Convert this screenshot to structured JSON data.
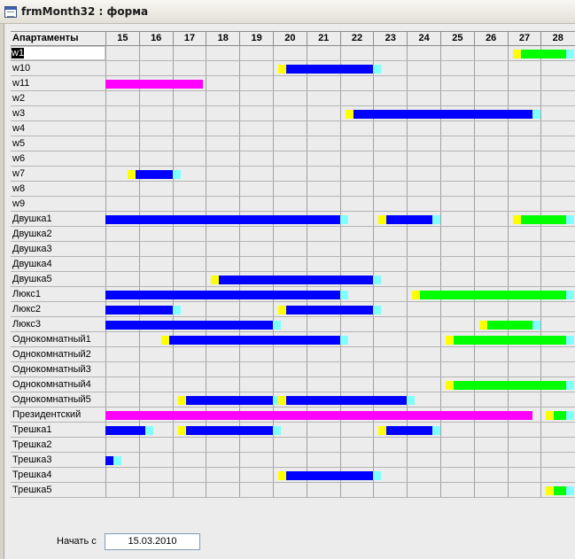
{
  "window": {
    "title": "frmMonth32 : форма"
  },
  "header": {
    "apartments": "Апартаменты",
    "days": [
      "15",
      "16",
      "17",
      "18",
      "19",
      "20",
      "21",
      "22",
      "23",
      "24",
      "25",
      "26",
      "27",
      "28"
    ]
  },
  "colors": {
    "blue": "#0000ff",
    "magenta": "#ff00ff",
    "green": "#00ff00",
    "yellow": "#ffff00",
    "cyan": "#80ffff"
  },
  "rows": [
    {
      "name": "w1",
      "bars": [
        {
          "from": 27.0,
          "to": 28.75,
          "color": "green"
        }
      ]
    },
    {
      "name": "w10",
      "bars": [
        {
          "from": 20.0,
          "to": 23.0,
          "color": "blue"
        }
      ]
    },
    {
      "name": "w11",
      "bars": [
        {
          "from": 15.0,
          "to": 17.9,
          "color": "magenta"
        }
      ]
    },
    {
      "name": "w2",
      "bars": []
    },
    {
      "name": "w3",
      "bars": [
        {
          "from": 22.0,
          "to": 27.75,
          "color": "blue"
        }
      ]
    },
    {
      "name": "w4",
      "bars": []
    },
    {
      "name": "w5",
      "bars": []
    },
    {
      "name": "w6",
      "bars": []
    },
    {
      "name": "w7",
      "bars": [
        {
          "from": 15.5,
          "to": 17.0,
          "color": "blue"
        }
      ]
    },
    {
      "name": "w8",
      "bars": []
    },
    {
      "name": "w9",
      "bars": []
    },
    {
      "name": "Двушка1",
      "bars": [
        {
          "from": 15.0,
          "to": 22.0,
          "color": "blue"
        },
        {
          "from": 23.0,
          "to": 24.75,
          "color": "blue"
        },
        {
          "from": 27.0,
          "to": 28.75,
          "color": "green"
        }
      ]
    },
    {
      "name": "Двушка2",
      "bars": []
    },
    {
      "name": "Двушка3",
      "bars": []
    },
    {
      "name": "Двушка4",
      "bars": []
    },
    {
      "name": "Двушка5",
      "bars": [
        {
          "from": 18.0,
          "to": 23.0,
          "color": "blue"
        }
      ]
    },
    {
      "name": "Люкс1",
      "bars": [
        {
          "from": 15.0,
          "to": 22.0,
          "color": "blue"
        },
        {
          "from": 24.0,
          "to": 28.75,
          "color": "green"
        }
      ]
    },
    {
      "name": "Люкс2",
      "bars": [
        {
          "from": 15.0,
          "to": 17.0,
          "color": "blue"
        },
        {
          "from": 20.0,
          "to": 23.0,
          "color": "blue"
        }
      ]
    },
    {
      "name": "Люкс3",
      "bars": [
        {
          "from": 15.0,
          "to": 20.0,
          "color": "blue"
        },
        {
          "from": 26.0,
          "to": 27.75,
          "color": "green"
        }
      ]
    },
    {
      "name": "Однокомнатный1",
      "bars": [
        {
          "from": 16.5,
          "to": 22.0,
          "color": "blue"
        },
        {
          "from": 25.0,
          "to": 28.75,
          "color": "green"
        }
      ]
    },
    {
      "name": "Однокомнатный2",
      "bars": []
    },
    {
      "name": "Однокомнатный3",
      "bars": []
    },
    {
      "name": "Однокомнатный4",
      "bars": [
        {
          "from": 25.0,
          "to": 28.75,
          "color": "green"
        }
      ]
    },
    {
      "name": "Однокомнатный5",
      "bars": [
        {
          "from": 17.0,
          "to": 20.0,
          "color": "blue"
        },
        {
          "from": 20.0,
          "to": 24.0,
          "color": "blue"
        }
      ]
    },
    {
      "name": "Президентский",
      "bars": [
        {
          "from": 15.0,
          "to": 27.75,
          "color": "magenta"
        },
        {
          "from": 28.0,
          "to": 28.75,
          "color": "green"
        }
      ]
    },
    {
      "name": "Трешка1",
      "bars": [
        {
          "from": 15.0,
          "to": 16.2,
          "color": "blue"
        },
        {
          "from": 17.0,
          "to": 20.0,
          "color": "blue"
        },
        {
          "from": 23.0,
          "to": 24.75,
          "color": "blue"
        }
      ]
    },
    {
      "name": "Трешка2",
      "bars": []
    },
    {
      "name": "Трешка3",
      "bars": [
        {
          "from": 15.0,
          "to": 15.25,
          "color": "blue"
        }
      ]
    },
    {
      "name": "Трешка4",
      "bars": [
        {
          "from": 20.0,
          "to": 23.0,
          "color": "blue"
        }
      ]
    },
    {
      "name": "Трешка5",
      "bars": [
        {
          "from": 28.0,
          "to": 28.75,
          "color": "green"
        }
      ]
    }
  ],
  "footer": {
    "label": "Начать с",
    "start_date": "15.03.2010"
  }
}
